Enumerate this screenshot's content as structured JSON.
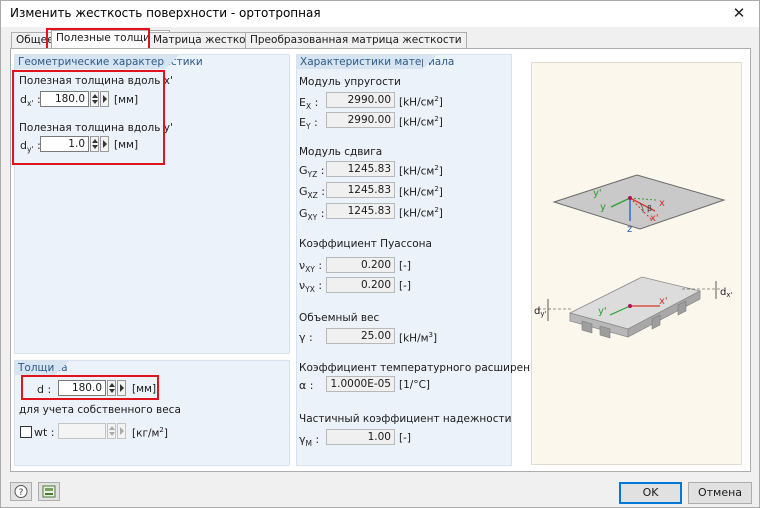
{
  "window": {
    "title": "Изменить жесткость поверхности - ортотропная"
  },
  "tabs": [
    {
      "label": "Общее"
    },
    {
      "label": "Полезные толщины"
    },
    {
      "label": "Матрица жесткости"
    },
    {
      "label": "Преобразованная матрица жесткости"
    }
  ],
  "geometry": {
    "title": "Геометрические характеристики",
    "x_label": "Полезная толщина вдоль x'",
    "x_symbol": "d",
    "x_sub": "x'",
    "x_value": "180.0",
    "x_unit": "[мм]",
    "y_label": "Полезная толщина вдоль y'",
    "y_symbol": "d",
    "y_sub": "y'",
    "y_value": "1.0",
    "y_unit": "[мм]"
  },
  "thickness": {
    "title": "Толщина",
    "d_symbol": "d :",
    "d_value": "180.0",
    "d_unit": "[мм]",
    "self_weight_label": "для учета собственного веса",
    "wt_symbol": "wt :",
    "wt_value": "",
    "wt_unit": "[кг/м",
    "wt_unit_sup": "2",
    "wt_unit_close": "]",
    "wt_checked": false
  },
  "material": {
    "title": "Характеристики материала",
    "elasticity_label": "Модуль упругости",
    "ex_sym": "E",
    "ex_sub": "X",
    "ex_value": "2990.00",
    "ex_unit": "[kH/см",
    "ex_unit_sup": "2",
    "ex_unit_close": "]",
    "ey_sym": "E",
    "ey_sub": "Y",
    "ey_value": "2990.00",
    "ey_unit": "[kH/см",
    "ey_unit_sup": "2",
    "ey_unit_close": "]",
    "shear_label": "Модуль сдвига",
    "gyz_sym": "G",
    "gyz_sub": "YZ",
    "gyz_value": "1245.83",
    "gyz_unit": "[kH/см",
    "gyz_unit_sup": "2",
    "gyz_unit_close": "]",
    "gxz_sym": "G",
    "gxz_sub": "XZ",
    "gxz_value": "1245.83",
    "gxz_unit": "[kH/см",
    "gxz_unit_sup": "2",
    "gxz_unit_close": "]",
    "gxy_sym": "G",
    "gxy_sub": "XY",
    "gxy_value": "1245.83",
    "gxy_unit": "[kH/см",
    "gxy_unit_sup": "2",
    "gxy_unit_close": "]",
    "poisson_label": "Коэффициент Пуассона",
    "nxy_sym": "ν",
    "nxy_sub": "XY",
    "nxy_value": "0.200",
    "nxy_unit": "[-]",
    "nyx_sym": "ν",
    "nyx_sub": "YX",
    "nyx_value": "0.200",
    "nyx_unit": "[-]",
    "weight_label": "Объемный вес",
    "gamma_sym": "γ :",
    "gamma_value": "25.00",
    "gamma_unit": "[kH/м",
    "gamma_unit_sup": "3",
    "gamma_unit_close": "]",
    "thermal_label": "Коэффициент температурного расширения",
    "alpha_sym": "α :",
    "alpha_value": "1.0000E-05",
    "alpha_unit": "[1/°C]",
    "safety_label": "Частичный коэффициент надежности",
    "gm_sym": "γ",
    "gm_sub": "M",
    "gm_value": "1.00",
    "gm_unit": "[-]"
  },
  "diagram": {
    "top_y": "y'",
    "top_y2": "y",
    "top_x": "x",
    "top_x2": "x'",
    "top_z": "z",
    "top_beta": "β",
    "bot_y": "y'",
    "bot_x": "x'",
    "dim_dy": "d",
    "dim_dy_sub": "y'",
    "dim_dx": "d",
    "dim_dx_sub": "x'"
  },
  "footer": {
    "ok": "OK",
    "cancel": "Отмена"
  },
  "colors": {
    "highlight": "#e0141e",
    "group_bg": "#ecf2f9",
    "group_title": "#2d5a86",
    "accent": "#0078d7"
  }
}
